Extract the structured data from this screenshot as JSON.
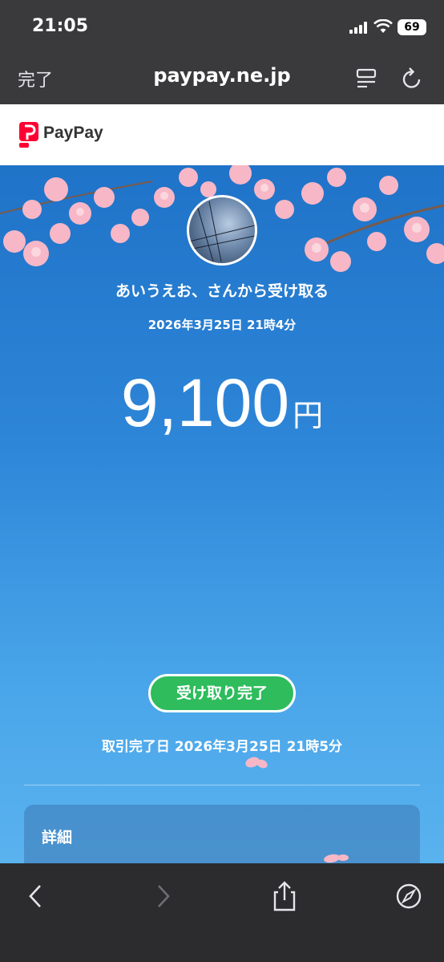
{
  "status_bar": {
    "time": "21:05",
    "battery": "69"
  },
  "browser": {
    "done_label": "完了",
    "url": "paypay.ne.jp"
  },
  "app": {
    "logo_text": "PayPay"
  },
  "transfer": {
    "sender_text": "あいうえお、さんから受け取る",
    "date": "2026年3月25日 21時4分",
    "amount": "9,100",
    "currency": "円",
    "status_badge": "受け取り完了",
    "completed_text": "取引完了日 2026年3月25日 21時5分"
  },
  "detail": {
    "title": "詳細"
  },
  "colors": {
    "brand_red": "#ff0033",
    "badge_green": "#2ebc5c",
    "bg_blue": "#2e86d8"
  },
  "icons": [
    "signal-icon",
    "wifi-icon",
    "reader-icon",
    "reload-icon",
    "back-icon",
    "forward-icon",
    "share-icon",
    "compass-icon"
  ]
}
